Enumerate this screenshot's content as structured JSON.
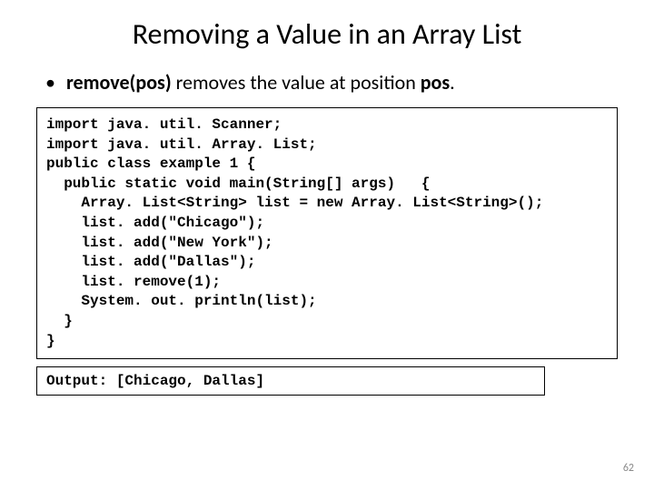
{
  "title": "Removing a Value in an Array List",
  "bullet": {
    "part1": "remove(pos)",
    "part2": " removes the value at position ",
    "part3": "pos",
    "part4": "."
  },
  "code": {
    "l1": "import java. util. Scanner;",
    "l2": "import java. util. Array. List;",
    "l3": "",
    "l4": "public class example 1 {",
    "l5": "  public static void main(String[] args)   {",
    "l6": "    Array. List<String> list = new Array. List<String>();",
    "l7": "    list. add(\"Chicago\");",
    "l8": "    list. add(\"New York\");",
    "l9": "    list. add(\"Dallas\");",
    "l10": "    list. remove(1);",
    "l11": "    System. out. println(list);",
    "l12": "  }",
    "l13": "}"
  },
  "output": "Output:  [Chicago, Dallas]",
  "pagenum": "62"
}
